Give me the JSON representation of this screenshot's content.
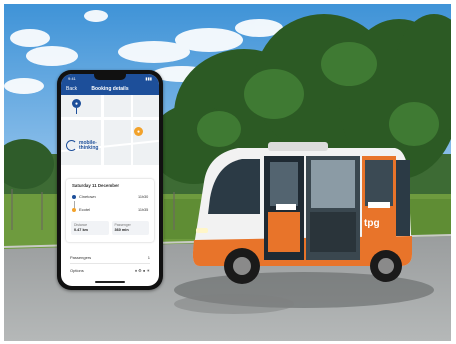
{
  "phone": {
    "status_time": "9:41",
    "status_icons": "▮▮▮",
    "app_bar": {
      "back_label": "Back",
      "title": "Booking details"
    },
    "brand_logo_text": "mobile-thinking",
    "trip": {
      "date": "Saturday 11 December",
      "origin_name": "Cinetown",
      "origin_time": "11h30",
      "destination_name": "Ecotel",
      "destination_time": "11h35",
      "metric_1_label": "Distance",
      "metric_1_value": "0.47 km",
      "metric_2_label": "Passenger",
      "metric_2_value": "360 min"
    },
    "rows": [
      {
        "label": "Passengers",
        "value": "1"
      },
      {
        "label": "Options",
        "value": "♦ ⚙ ● ☀"
      }
    ]
  },
  "shuttle_brand": "tpg",
  "colors": {
    "app_blue": "#1d4f9a",
    "pin_orange": "#f2a22b",
    "shuttle_orange": "#e8742a"
  }
}
